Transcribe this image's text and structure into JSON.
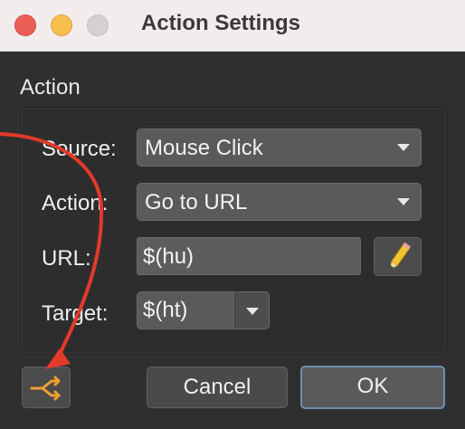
{
  "window": {
    "title": "Action Settings"
  },
  "group": {
    "title": "Action"
  },
  "form": {
    "source_label": "Source:",
    "source_value": "Mouse Click",
    "action_label": "Action:",
    "action_value": "Go to URL",
    "url_label": "URL:",
    "url_value": "$(hu)",
    "target_label": "Target:",
    "target_value": "$(ht)"
  },
  "buttons": {
    "cancel": "Cancel",
    "ok": "OK"
  },
  "icons": {
    "edit": "pencil-icon",
    "routing": "branch-arrows-icon"
  },
  "colors": {
    "annotation_arrow": "#e23a2a",
    "accent_orange": "#f0a030",
    "ok_border": "#6f8fb0"
  }
}
